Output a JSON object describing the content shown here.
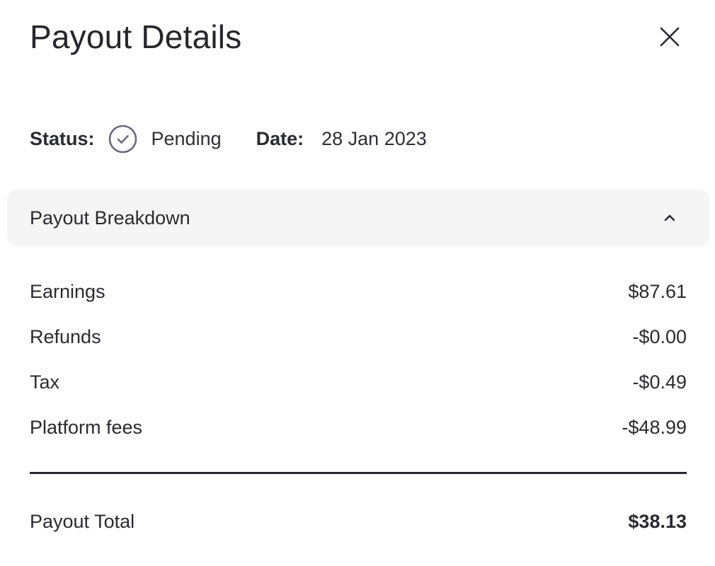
{
  "header": {
    "title": "Payout Details"
  },
  "summary": {
    "status_label": "Status:",
    "status_value": "Pending",
    "status_icon": "check-circle-icon",
    "date_label": "Date:",
    "date_value": "28 Jan 2023"
  },
  "breakdown": {
    "title": "Payout Breakdown",
    "expanded": true,
    "rows": [
      {
        "label": "Earnings",
        "value": "$87.61"
      },
      {
        "label": "Refunds",
        "value": "-$0.00"
      },
      {
        "label": "Tax",
        "value": "-$0.49"
      },
      {
        "label": "Platform fees",
        "value": "-$48.99"
      }
    ],
    "total_label": "Payout Total",
    "total_value": "$38.13"
  },
  "colors": {
    "text": "#2a2a31",
    "panel_background": "#f5f5f6",
    "icon_stroke": "#6b6a7b"
  }
}
